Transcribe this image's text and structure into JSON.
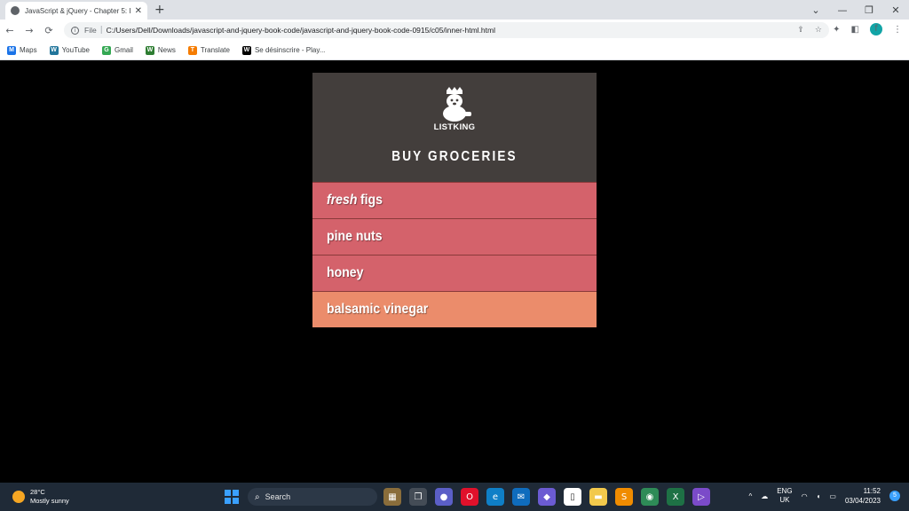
{
  "browser": {
    "tab_title": "JavaScript & jQuery - Chapter 5: I",
    "tab_close": "✕",
    "new_tab": "+",
    "window": {
      "minimize": "—",
      "restore": "❐",
      "close": "✕",
      "collapse": "⌄"
    },
    "nav": {
      "back": "←",
      "forward": "→",
      "reload": "⟳"
    },
    "address": {
      "scheme": "File",
      "separator": "|",
      "url": "C:/Users/Dell/Downloads/javascript-and-jquery-book-code/javascript-and-jquery-book-code-0915/c05/inner-html.html"
    },
    "toolbar_icons": {
      "share": "⇪",
      "star": "☆",
      "extensions": "✦",
      "sidepanel": "◧",
      "menu": "⋮"
    },
    "profile_initial": "f",
    "bookmarks": [
      {
        "label": "Maps",
        "icon": "maps-icon",
        "color": "#1a73e8",
        "glyph": "M"
      },
      {
        "label": "YouTube",
        "icon": "wordpress-icon",
        "color": "#21759b",
        "glyph": "W"
      },
      {
        "label": "Gmail",
        "icon": "gmail-icon",
        "color": "#34a853",
        "glyph": "G"
      },
      {
        "label": "News",
        "icon": "news-icon",
        "color": "#2e7d32",
        "glyph": "W"
      },
      {
        "label": "Translate",
        "icon": "translate-icon",
        "color": "#f57c00",
        "glyph": "T"
      },
      {
        "label": "Se désinscrire - Play...",
        "icon": "w-icon",
        "color": "#000000",
        "glyph": "W"
      }
    ]
  },
  "app": {
    "logo_text": "LISTKING",
    "title": "BUY GROCERIES",
    "items": [
      {
        "emphasis": "fresh",
        "label": "figs",
        "state": "hot"
      },
      {
        "emphasis": "",
        "label": "pine nuts",
        "state": "hot"
      },
      {
        "emphasis": "",
        "label": "honey",
        "state": "hot"
      },
      {
        "emphasis": "",
        "label": "balsamic vinegar",
        "state": "cool"
      }
    ],
    "colors": {
      "header": "#433e3c",
      "hot": "#d4626b",
      "cool": "#eb8c6b"
    }
  },
  "taskbar": {
    "weather_temp": "28°C",
    "weather_desc": "Mostly sunny",
    "search_label": "Search",
    "search_icon": "⌕",
    "lang_top": "ENG",
    "lang_bottom": "UK",
    "time": "11:52",
    "date": "03/04/2023",
    "notifications": "5",
    "tray": {
      "chevron": "^",
      "cloud": "☁",
      "wifi": "◠",
      "volume": "◖",
      "battery": "▭"
    },
    "apps": [
      {
        "name": "widgets-app-icon",
        "color": "#8a6d3b",
        "glyph": "▦"
      },
      {
        "name": "task-view-icon",
        "color": "#444c56",
        "glyph": "❐"
      },
      {
        "name": "teams-icon",
        "color": "#5b5fc7",
        "glyph": "●"
      },
      {
        "name": "opera-icon",
        "color": "#e0112b",
        "glyph": "O"
      },
      {
        "name": "edge-icon",
        "color": "#0f7fc7",
        "glyph": "e"
      },
      {
        "name": "mail-icon",
        "color": "#0f6cbd",
        "glyph": "✉"
      },
      {
        "name": "app-icon",
        "color": "#6b5bd2",
        "glyph": "◆"
      },
      {
        "name": "file-icon",
        "color": "#ffffff",
        "glyph": "▯"
      },
      {
        "name": "explorer-icon",
        "color": "#f2c94c",
        "glyph": "▬"
      },
      {
        "name": "sublime-icon",
        "color": "#f08c00",
        "glyph": "S"
      },
      {
        "name": "chrome-icon",
        "color": "#2e8b57",
        "glyph": "◉"
      },
      {
        "name": "excel-icon",
        "color": "#1e7145",
        "glyph": "X"
      },
      {
        "name": "visual-studio-icon",
        "color": "#7b4bc9",
        "glyph": "▷"
      }
    ]
  }
}
